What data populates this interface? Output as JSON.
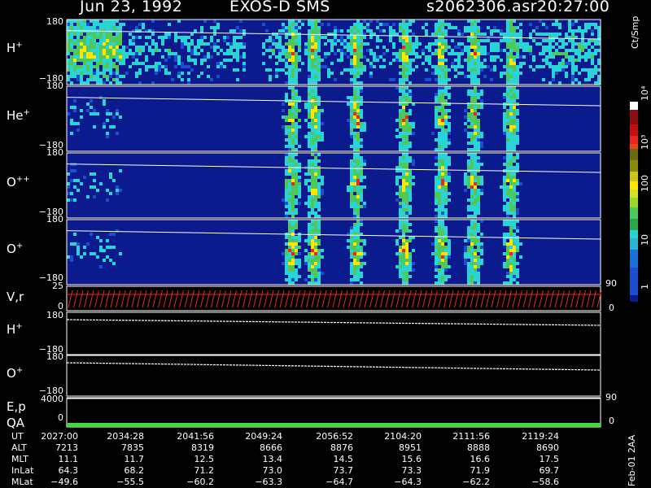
{
  "header": {
    "date": "Jun 23, 1992",
    "instrument": "EXOS-D SMS",
    "file": "s2062306.asr",
    "time": "20:27:00"
  },
  "panels": [
    {
      "label": "H",
      "sup": "+",
      "ytop": "180",
      "ybot": "−180"
    },
    {
      "label": "He",
      "sup": "+",
      "ytop": "180",
      "ybot": "−180"
    },
    {
      "label": "O",
      "sup": "++",
      "ytop": "180",
      "ybot": "−180"
    },
    {
      "label": "O",
      "sup": "+",
      "ytop": "180",
      "ybot": "−180"
    }
  ],
  "line_panels": [
    {
      "label": "V,r",
      "ytop": "25",
      "ybot": "0",
      "rtop": "90",
      "rbot": "0"
    },
    {
      "label": "H",
      "sup": "+",
      "ytop": "180",
      "ybot": "−180"
    },
    {
      "label": "O",
      "sup": "+",
      "ytop": "180",
      "ybot": "−180"
    },
    {
      "label": "E,p",
      "ytop": "4000",
      "ybot": "",
      "rtop": "90",
      "rbot": ""
    },
    {
      "label": "QA",
      "ytop": "",
      "ybot": "0",
      "rtop": "",
      "rbot": "0"
    }
  ],
  "colorbar": {
    "unit": "Ct/Smp",
    "ticks": [
      "10⁴",
      "10³",
      "100",
      "10",
      "1"
    ]
  },
  "side_tag": "Feb-01 2AA",
  "chart_data": {
    "type": "heatmap",
    "title": "Jun 23, 1992   EXOS-D SMS",
    "x_axis": {
      "UT": [
        "2027:00",
        "2034:28",
        "2041:56",
        "2049:24",
        "2056:52",
        "2104:20",
        "2111:56",
        "2119:24"
      ],
      "ALT": [
        "7213",
        "7835",
        "8319",
        "8666",
        "8876",
        "8951",
        "8888",
        "8690"
      ],
      "MLT": [
        "11.1",
        "11.7",
        "12.5",
        "13.4",
        "14.5",
        "15.6",
        "16.6",
        "17.5"
      ],
      "InLat": [
        "64.3",
        "68.2",
        "71.2",
        "73.0",
        "73.7",
        "73.3",
        "71.9",
        "69.7"
      ],
      "MLat": [
        "−49.6",
        "−55.5",
        "−60.2",
        "−63.3",
        "−64.7",
        "−64.3",
        "−62.2",
        "−58.6"
      ]
    },
    "ylim": [
      -180,
      180
    ],
    "color_scale": "log",
    "color_range": [
      1,
      10000
    ],
    "colors": {
      "background": "#0b1a8c",
      "low": "#2ad4d4",
      "mid": "#4ec85a",
      "high": "#ffe600",
      "peak": "#e8281e"
    }
  }
}
